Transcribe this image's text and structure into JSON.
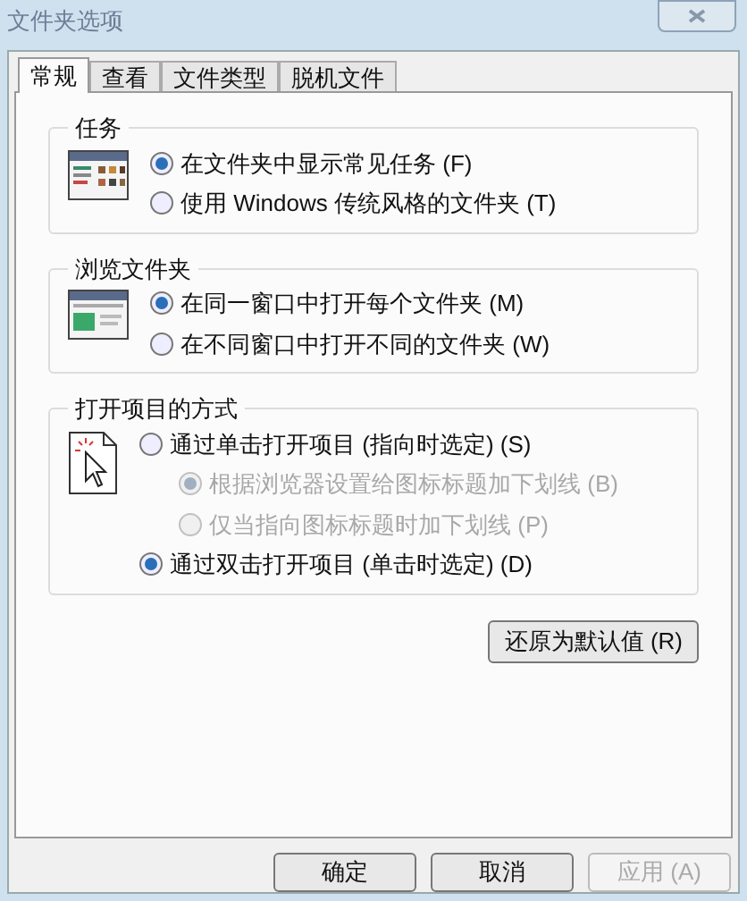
{
  "window": {
    "title": "文件夹选项"
  },
  "tabs": [
    {
      "label": "常规",
      "selected": true
    },
    {
      "label": "查看",
      "selected": false
    },
    {
      "label": "文件类型",
      "selected": false
    },
    {
      "label": "脱机文件",
      "selected": false
    }
  ],
  "groups": [
    {
      "title": "任务",
      "kind": "tasks",
      "options": [
        {
          "label": "在文件夹中显示常见任务 (F)",
          "selected": true,
          "disabled": false
        },
        {
          "label": "使用 Windows 传统风格的文件夹 (T)",
          "selected": false,
          "disabled": false
        }
      ]
    },
    {
      "title": "浏览文件夹",
      "kind": "window",
      "options": [
        {
          "label": "在同一窗口中打开每个文件夹 (M)",
          "selected": true,
          "disabled": false
        },
        {
          "label": "在不同窗口中打开不同的文件夹 (W)",
          "selected": false,
          "disabled": false
        }
      ]
    },
    {
      "title": "打开项目的方式",
      "kind": "click",
      "options": [
        {
          "label": "通过单击打开项目 (指向时选定) (S)",
          "selected": false,
          "disabled": false,
          "children": [
            {
              "label": "根据浏览器设置给图标标题加下划线 (B)",
              "selected": true,
              "disabled": true
            },
            {
              "label": "仅当指向图标标题时加下划线 (P)",
              "selected": false,
              "disabled": true
            }
          ]
        },
        {
          "label": "通过双击打开项目 (单击时选定) (D)",
          "selected": true,
          "disabled": false
        }
      ]
    }
  ],
  "restore_button": "还原为默认值 (R)",
  "buttons": [
    {
      "label": "确定",
      "disabled": false
    },
    {
      "label": "取消",
      "disabled": false
    },
    {
      "label": "应用 (A)",
      "disabled": true
    }
  ]
}
